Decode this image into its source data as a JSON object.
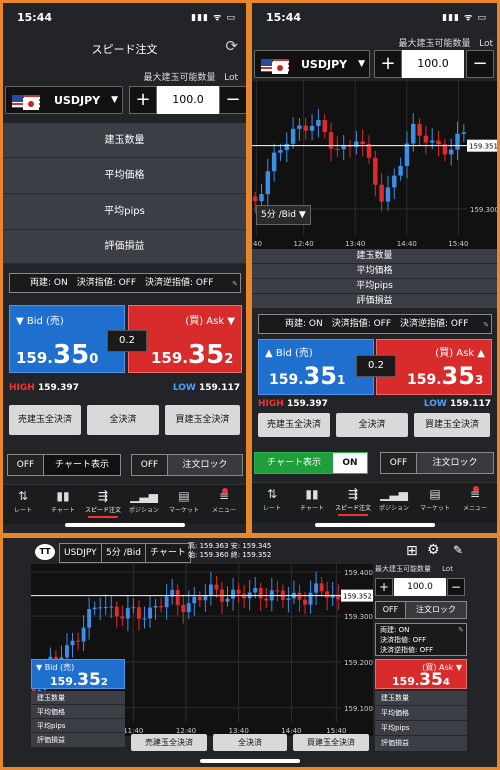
{
  "status": {
    "time": "15:44",
    "icons": "▮▮▮ ᯤ ▭"
  },
  "p1": {
    "title": "スピード注文",
    "max_label": "最大建玉可能数量",
    "lot": "Lot",
    "pair": "USDJPY",
    "qty": "100.0",
    "plus": "+",
    "minus": "−",
    "info": [
      "建玉数量",
      "平均価格",
      "平均pips",
      "評価損益"
    ],
    "options": "両建: ON　決済指値: OFF　決済逆指値: OFF",
    "bid_label": "▼ Bid (売)",
    "ask_label": "(買) Ask ▼",
    "bid": {
      "pre": "159.",
      "big": "35",
      "small": "0"
    },
    "ask": {
      "pre": "159.",
      "big": "35",
      "small": "2"
    },
    "spread": "0.2",
    "high_label": "HIGH",
    "high": "159.397",
    "low_label": "LOW",
    "low": "159.117",
    "buttons": [
      "売建玉全決済",
      "全決済",
      "買建玉全決済"
    ],
    "toggle_chart": {
      "state": "OFF",
      "label": "チャート表示"
    },
    "toggle_lock": {
      "state": "OFF",
      "label": "注文ロック"
    }
  },
  "p2": {
    "max_label": "最大建玉可能数量",
    "lot": "Lot",
    "pair": "USDJPY",
    "qty": "100.0",
    "plus": "+",
    "minus": "−",
    "interval": "5分 /Bid ▼",
    "price_tag": "159.351",
    "y_ticks": [
      "159.300"
    ],
    "x_ticks": [
      ":40",
      "12:40",
      "13:40",
      "14:40",
      "15:40"
    ],
    "info": [
      "建玉数量",
      "平均価格",
      "平均pips",
      "評価損益"
    ],
    "options": "両建: ON　決済指値: OFF　決済逆指値: OFF",
    "bid_label": "▲ Bid (売)",
    "ask_label": "(買) Ask ▲",
    "bid": {
      "pre": "159.",
      "big": "35",
      "small": "1"
    },
    "ask": {
      "pre": "159.",
      "big": "35",
      "small": "3"
    },
    "spread": "0.2",
    "high_label": "HIGH",
    "high": "159.397",
    "low_label": "LOW",
    "low": "159.117",
    "buttons": [
      "売建玉全決済",
      "全決済",
      "買建玉全決済"
    ],
    "toggle_chart": {
      "state": "ON",
      "label": "チャート表示"
    },
    "toggle_lock": {
      "state": "OFF",
      "label": "注文ロック"
    }
  },
  "tabs": [
    {
      "icon": "⇅",
      "label": "レート"
    },
    {
      "icon": "▮▮",
      "label": "チャート"
    },
    {
      "icon": "⇶",
      "label": "スピード注文"
    },
    {
      "icon": "▁▃▅",
      "label": "ポジション"
    },
    {
      "icon": "▤",
      "label": "マーケット"
    },
    {
      "icon": "≡",
      "label": "メニュー"
    }
  ],
  "p3": {
    "pair": "USDJPY",
    "interval": "5分 /Bid",
    "chart_btn": "チャート",
    "ohlc": [
      "高: 159.363",
      "始: 159.360",
      "安: 159.345",
      "終: 159.352"
    ],
    "y_ticks": [
      "159.400",
      "159.300",
      "159.200",
      "159.100"
    ],
    "price_tag": "159.352",
    "x_ticks": [
      "11:40",
      "12:40",
      "13:40",
      "14:40",
      "15:40"
    ],
    "max_label": "最大建玉可能数量",
    "lot": "Lot",
    "qty": "100.0",
    "plus": "+",
    "minus": "−",
    "toggle_lock": {
      "state": "OFF",
      "label": "注文ロック"
    },
    "options": [
      "両建: ON",
      "決済指値: OFF",
      "決済逆指値: OFF"
    ],
    "bid_label": "▼ Bid (売)",
    "ask_label": "(買) Ask ▼",
    "bid": {
      "pre": "159.",
      "big": "35",
      "small": "2"
    },
    "ask": {
      "pre": "159.",
      "big": "35",
      "small": "4"
    },
    "info": [
      "建玉数量",
      "平均価格",
      "平均pips",
      "評価損益"
    ],
    "buttons": [
      "売建玉全決済",
      "全決済",
      "買建玉全決済"
    ]
  },
  "colors": {
    "bid": "#1f6fcf",
    "ask": "#d82c2c",
    "bg": "#232427",
    "border": "#e9862c"
  }
}
